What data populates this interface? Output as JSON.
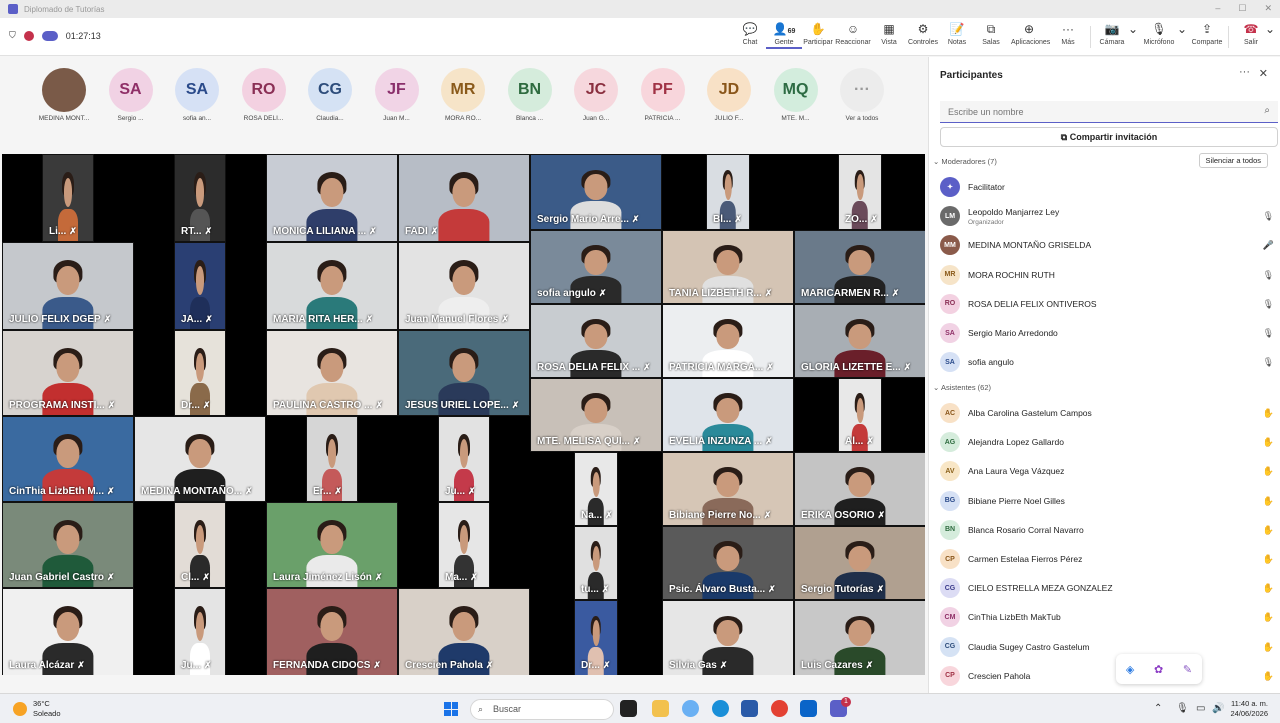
{
  "window": {
    "title": "Diplomado de Tutorías"
  },
  "meeting": {
    "timer": "01:27:13"
  },
  "toolbar": {
    "chat": "Chat",
    "people": "Gente",
    "people_count": "69",
    "raise": "Participar",
    "react": "Reaccionar",
    "view": "Vista",
    "controls": "Controles",
    "notes": "Notas",
    "rooms": "Salas",
    "apps": "Aplicaciones",
    "more": "Más",
    "camera": "Cámara",
    "mic": "Micrófono",
    "share": "Comparte",
    "leave": "Salir"
  },
  "strip": [
    {
      "initials": "",
      "name": "MEDINA MONT...",
      "bg": "#7a5a48",
      "fg": "#ffffff"
    },
    {
      "initials": "SA",
      "name": "Sergio ...",
      "bg": "#f1d2e4",
      "fg": "#8f2f67"
    },
    {
      "initials": "SA",
      "name": "sofia an...",
      "bg": "#d6e1f5",
      "fg": "#2a4a8a"
    },
    {
      "initials": "RO",
      "name": "ROSA DELI...",
      "bg": "#f3d1e1",
      "fg": "#8a2f55"
    },
    {
      "initials": "CG",
      "name": "Claudia...",
      "bg": "#d5e2f4",
      "fg": "#2e4d7b"
    },
    {
      "initials": "JF",
      "name": "Juan M...",
      "bg": "#f1d4e6",
      "fg": "#8a2f6b"
    },
    {
      "initials": "MR",
      "name": "MORA RO...",
      "bg": "#f6e4c8",
      "fg": "#8a5a1a"
    },
    {
      "initials": "BN",
      "name": "Blanca ...",
      "bg": "#d5ecdc",
      "fg": "#2e6b3f"
    },
    {
      "initials": "JC",
      "name": "Juan G...",
      "bg": "#f6d7dd",
      "fg": "#8a2f3f"
    },
    {
      "initials": "PF",
      "name": "PATRICIA ...",
      "bg": "#f8d6dc",
      "fg": "#a03245"
    },
    {
      "initials": "JD",
      "name": "JULIO F...",
      "bg": "#f8e1c6",
      "fg": "#8a561a"
    },
    {
      "initials": "MQ",
      "name": "MTE. M...",
      "bg": "#d3eddd",
      "fg": "#2d6b43"
    },
    {
      "initials": "···",
      "name": "Ver a todos",
      "bg": "#ececec",
      "fg": "#999999"
    }
  ],
  "tiles": [
    {
      "name": "Li...",
      "bg": "#3a3a3a",
      "body": "#c46a3a"
    },
    {
      "name": "RT...",
      "bg": "#2c2c2c",
      "body": "#555555"
    },
    {
      "name": "MONICA LILIANA ...",
      "bg": "#c8ccd4",
      "body": "#2f3e6a"
    },
    {
      "name": "FADI",
      "bg": "#b7bdc6",
      "body": "#c43a3a"
    },
    {
      "name": "Sergio Mario Arre...",
      "bg": "#3b5b88",
      "body": "#dddddd"
    },
    {
      "name": "Bl...",
      "bg": "#d9dde2",
      "body": "#4a5a78"
    },
    {
      "name": "ZO...",
      "bg": "#e4e4e4",
      "body": "#6a4a5a"
    },
    {
      "name": "JULIO FELIX DGEP",
      "bg": "#c5c8cc",
      "body": "#3a5a8a"
    },
    {
      "name": "JA...",
      "bg": "#2a3f73",
      "body": "#1f2f5a"
    },
    {
      "name": "MARIA RITA HER...",
      "bg": "#d8dadb",
      "body": "#2a7a7a"
    },
    {
      "name": "Juan Manuel Flores",
      "bg": "#e3e3e3",
      "body": "#eeeeee"
    },
    {
      "name": "sofia angulo",
      "bg": "#7a8a9a",
      "body": "#2a2a2a"
    },
    {
      "name": "TANIA LIZBETH R...",
      "bg": "#d4c4b4",
      "body": "#e0e0e0"
    },
    {
      "name": "MARICARMEN R...",
      "bg": "#6a7a8a",
      "body": "#222222"
    },
    {
      "name": "PROGRAMA INSTI...",
      "bg": "#d7d3cf",
      "body": "#c22f2f"
    },
    {
      "name": "Dr...",
      "bg": "#e6e2da",
      "body": "#8a6a4a"
    },
    {
      "name": "PAULINA CASTRO ...",
      "bg": "#e8e4e0",
      "body": "#e0c8b0"
    },
    {
      "name": "JESUS URIEL LOPE...",
      "bg": "#4a6a7a",
      "body": "#2a3a5a"
    },
    {
      "name": "ROSA DELIA FELIX ...",
      "bg": "#c8ccd0",
      "body": "#2a2a2a"
    },
    {
      "name": "PATRICIA MARGA...",
      "bg": "#eceef0",
      "body": "#ffffff"
    },
    {
      "name": "GLORIA LIZETTE E...",
      "bg": "#a8aeb4",
      "body": "#6a1f2a"
    },
    {
      "name": "MTE. MELISA QUI...",
      "bg": "#c8c0b8",
      "body": "#d8d0c8"
    },
    {
      "name": "EVELIA INZUNZA ...",
      "bg": "#dfe4ea",
      "body": "#2a8a9a"
    },
    {
      "name": "Al...",
      "bg": "#e8e8e8",
      "body": "#c43a3a"
    },
    {
      "name": "CinThia LizbEth M...",
      "bg": "#3a6aa0",
      "body": "#c43a3a"
    },
    {
      "name": "MEDINA MONTAÑO...",
      "bg": "#e6e6e6",
      "body": "#1f1f1f"
    },
    {
      "name": "Er...",
      "bg": "#d6d6d6",
      "body": "#c45a5a"
    },
    {
      "name": "Ju...",
      "bg": "#e2e2e2",
      "body": "#c43a4a"
    },
    {
      "name": "Na...",
      "bg": "#e8e8e8",
      "body": "#2a2a2a"
    },
    {
      "name": "Bibiane Pierre No...",
      "bg": "#d6c6b6",
      "body": "#8a6a5a"
    },
    {
      "name": "ERIKA OSORIO",
      "bg": "#c4c4c4",
      "body": "#1f1f1f"
    },
    {
      "name": "Juan Gabriel Castro",
      "bg": "#7a8a7a",
      "body": "#1f5a3a"
    },
    {
      "name": "Cl...",
      "bg": "#e2dcd6",
      "body": "#2a2a2a"
    },
    {
      "name": "Laura Jiménez Lisón",
      "bg": "#6aa06a",
      "body": "#eaeaea"
    },
    {
      "name": "Ma...",
      "bg": "#e6e6e6",
      "body": "#333333"
    },
    {
      "name": "tu...",
      "bg": "#e0e0e0",
      "body": "#2a2a2a"
    },
    {
      "name": "Psic. Álvaro Busta...",
      "bg": "#5a5a5a",
      "body": "#1a3a6a"
    },
    {
      "name": "Sergio Tutorías",
      "bg": "#b0a090",
      "body": "#1f2f4a"
    },
    {
      "name": "Laura Alcázar",
      "bg": "#f0f0f0",
      "body": "#2a2a2a"
    },
    {
      "name": "Ju...",
      "bg": "#e4e4e4",
      "body": "#ffffff"
    },
    {
      "name": "FERNANDA CIDOCS",
      "bg": "#a06060",
      "body": "#1f1f1f"
    },
    {
      "name": "Crescien Pahola",
      "bg": "#d8d0c8",
      "body": "#1f3a6a"
    },
    {
      "name": "Dr...",
      "bg": "#3a5aa0",
      "body": "#e0c0b0"
    },
    {
      "name": "Silvia Gas",
      "bg": "#e6e6e6",
      "body": "#2a2a2a"
    },
    {
      "name": "Luis Cazares",
      "bg": "#c8c8c8",
      "body": "#2a4a2a"
    }
  ],
  "panel": {
    "title": "Participantes",
    "search_placeholder": "Escribe un nombre",
    "share_invite": "Compartir invitación",
    "moderators_label": "Moderadores (7)",
    "mute_all": "Silenciar a todos",
    "attendees_label": "Asistentes (62)",
    "moderators": [
      {
        "initials": "✦",
        "name": "Facilitator",
        "sub": "",
        "bg": "#5b5fc7",
        "fg": "#ffffff",
        "mic": ""
      },
      {
        "initials": "LM",
        "name": "Leopoldo Manjarrez Ley",
        "sub": "Organizador",
        "bg": "#6a6a6a",
        "fg": "#ffffff",
        "mic": "🎙"
      },
      {
        "initials": "MM",
        "name": "MEDINA MONTAÑO GRISELDA",
        "sub": "",
        "bg": "#8a5a4a",
        "fg": "#ffffff",
        "mic": "🎤"
      },
      {
        "initials": "MR",
        "name": "MORA ROCHIN RUTH",
        "sub": "",
        "bg": "#f6e4c8",
        "fg": "#8a5a1a",
        "mic": "🎙"
      },
      {
        "initials": "RO",
        "name": "ROSA DELIA FELIX ONTIVEROS",
        "sub": "",
        "bg": "#f3d1e1",
        "fg": "#8a2f55",
        "mic": "🎙"
      },
      {
        "initials": "SA",
        "name": "Sergio Mario Arredondo",
        "sub": "",
        "bg": "#f1d2e4",
        "fg": "#8f2f67",
        "mic": "🎙"
      },
      {
        "initials": "SA",
        "name": "sofia angulo",
        "sub": "",
        "bg": "#d6e1f5",
        "fg": "#2a4a8a",
        "mic": "🎙"
      }
    ],
    "attendees": [
      {
        "initials": "AC",
        "name": "Alba Carolina Gastelum Campos",
        "bg": "#f8e1c6",
        "fg": "#8a561a"
      },
      {
        "initials": "AG",
        "name": "Alejandra Lopez Gallardo",
        "bg": "#d5ecdc",
        "fg": "#2e6b3f"
      },
      {
        "initials": "AV",
        "name": "Ana Laura Vega Vázquez",
        "bg": "#f8e6c6",
        "fg": "#8a601a"
      },
      {
        "initials": "BG",
        "name": "Bibiane Pierre Noel Gilles",
        "bg": "#d6e1f5",
        "fg": "#2a4a8a"
      },
      {
        "initials": "BN",
        "name": "Blanca Rosario Corral Navarro",
        "bg": "#d5ecdc",
        "fg": "#2e6b3f"
      },
      {
        "initials": "CP",
        "name": "Carmen Estelaa Fierros Pérez",
        "bg": "#f8e1c6",
        "fg": "#8a561a"
      },
      {
        "initials": "CG",
        "name": "CIELO ESTRELLA MEZA GONZALEZ",
        "bg": "#dcdcf4",
        "fg": "#3a3a8a"
      },
      {
        "initials": "CM",
        "name": "CinThia LizbEth MakTub",
        "bg": "#f1d2e4",
        "fg": "#8f2f67"
      },
      {
        "initials": "CG",
        "name": "Claudia Sugey Castro Gastelum",
        "bg": "#d5e2f4",
        "fg": "#2e4d7b"
      },
      {
        "initials": "CP",
        "name": "Crescien Pahola",
        "bg": "#f8d6dc",
        "fg": "#a03245"
      }
    ]
  },
  "taskbar": {
    "temp": "36°C",
    "weather": "Soleado",
    "search": "Buscar",
    "time": "11:40 a. m.",
    "date": "24/06/2026",
    "badge": "1"
  }
}
